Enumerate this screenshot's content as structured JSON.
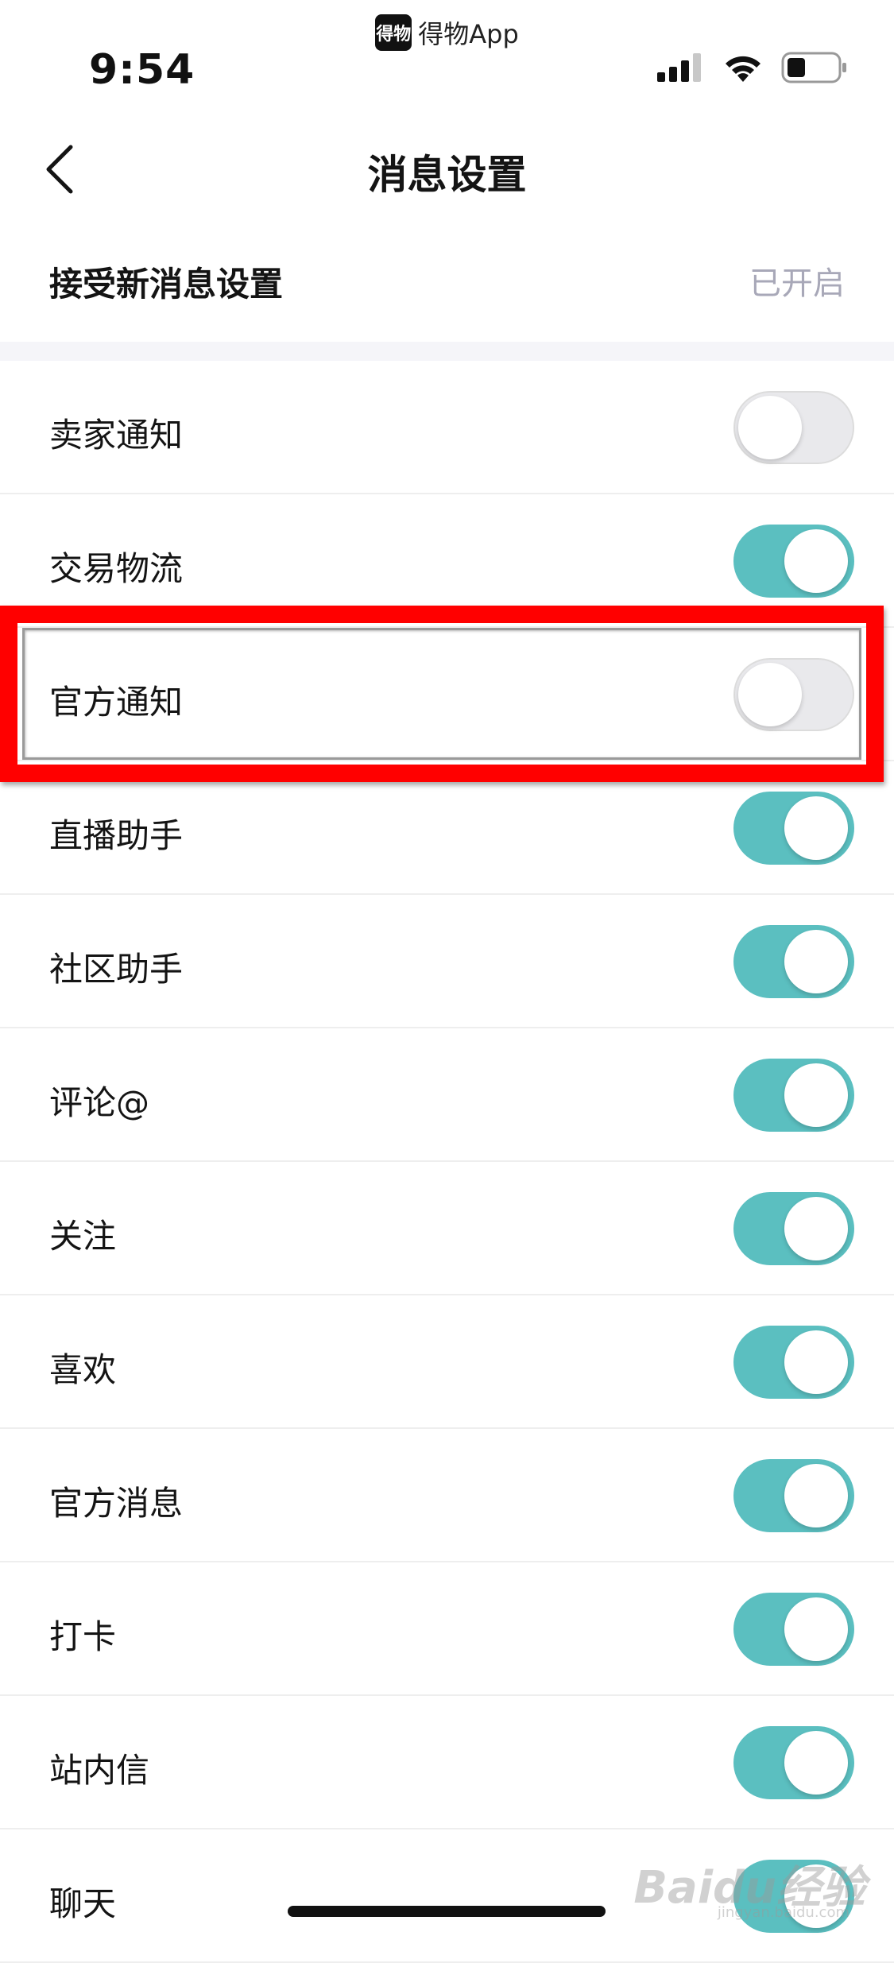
{
  "status_bar": {
    "app_indicator_logo": "得物",
    "app_indicator_name": "得物App",
    "time": "9:54"
  },
  "nav": {
    "title": "消息设置",
    "back_icon": "chevron-left-icon"
  },
  "master": {
    "label": "接受新消息设置",
    "value": "已开启"
  },
  "settings": [
    {
      "label": "卖家通知",
      "on": false
    },
    {
      "label": "交易物流",
      "on": true
    },
    {
      "label": "官方通知",
      "on": false
    },
    {
      "label": "直播助手",
      "on": true
    },
    {
      "label": "社区助手",
      "on": true
    },
    {
      "label": "评论@",
      "on": true
    },
    {
      "label": "关注",
      "on": true
    },
    {
      "label": "喜欢",
      "on": true
    },
    {
      "label": "官方消息",
      "on": true
    },
    {
      "label": "打卡",
      "on": true
    },
    {
      "label": "站内信",
      "on": true
    },
    {
      "label": "聊天",
      "on": true
    }
  ],
  "watermark": {
    "logo": "Baidu经验",
    "sub": "jingyan.baidu.com"
  },
  "colors": {
    "toggle_on": "#5bbfc0",
    "toggle_off": "#e9e9ec",
    "highlight": "#ff0000"
  }
}
